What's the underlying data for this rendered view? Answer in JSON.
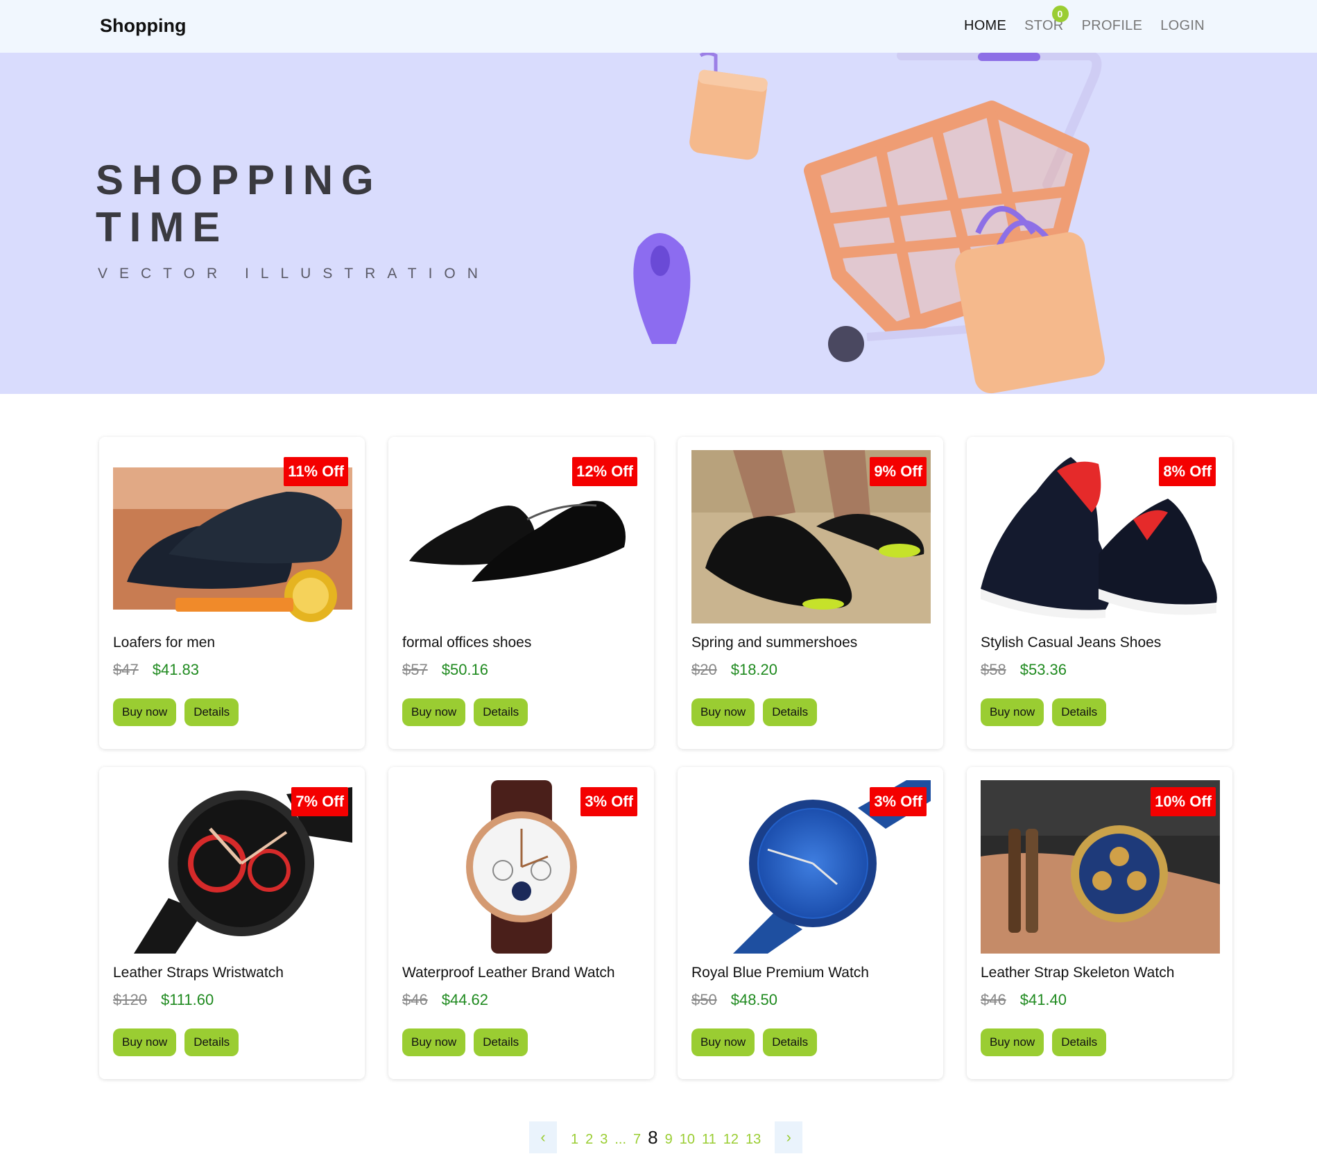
{
  "navbar": {
    "brand": "Shopping",
    "links": [
      "HOME",
      "STOR",
      "PROFILE",
      "LOGIN"
    ],
    "cart_count": "0"
  },
  "hero": {
    "title": "SHOPPING\nTIME",
    "subtitle": "VECTOR ILLUSTRATION"
  },
  "products": [
    {
      "title": "Loafers for men",
      "discount": "11% Off",
      "old_price": "$47",
      "new_price": "$41.83",
      "image": "loafers-image"
    },
    {
      "title": "formal offices shoes",
      "discount": "12% Off",
      "old_price": "$57",
      "new_price": "$50.16",
      "image": "formal-shoes-image"
    },
    {
      "title": "Spring and summershoes",
      "discount": "9% Off",
      "old_price": "$20",
      "new_price": "$18.20",
      "image": "summer-shoes-image"
    },
    {
      "title": "Stylish Casual Jeans Shoes",
      "discount": "8% Off",
      "old_price": "$58",
      "new_price": "$53.36",
      "image": "casual-shoes-image"
    },
    {
      "title": "Leather Straps Wristwatch",
      "discount": "7% Off",
      "old_price": "$120",
      "new_price": "$111.60",
      "image": "naviforce-watch-image"
    },
    {
      "title": "Waterproof Leather Brand Watch",
      "discount": "3% Off",
      "old_price": "$46",
      "new_price": "$44.62",
      "image": "skmei-watch-image"
    },
    {
      "title": "Royal Blue Premium Watch",
      "discount": "3% Off",
      "old_price": "$50",
      "new_price": "$48.50",
      "image": "biden-watch-image"
    },
    {
      "title": "Leather Strap Skeleton Watch",
      "discount": "10% Off",
      "old_price": "$46",
      "new_price": "$41.40",
      "image": "skeleton-watch-image"
    }
  ],
  "buttons": {
    "buy": "Buy now",
    "details": "Details"
  },
  "pagination": {
    "prev": "‹",
    "next": "›",
    "pages": [
      "1",
      "2",
      "3",
      "...",
      "7",
      "8",
      "9",
      "10",
      "11",
      "12",
      "13"
    ],
    "current": "8"
  },
  "colors": {
    "accent": "#9acd32",
    "badge": "#f40000",
    "price": "#1f8a1f",
    "hero_bg": "#d9dcfd",
    "nav_bg": "#f1f7fe"
  }
}
